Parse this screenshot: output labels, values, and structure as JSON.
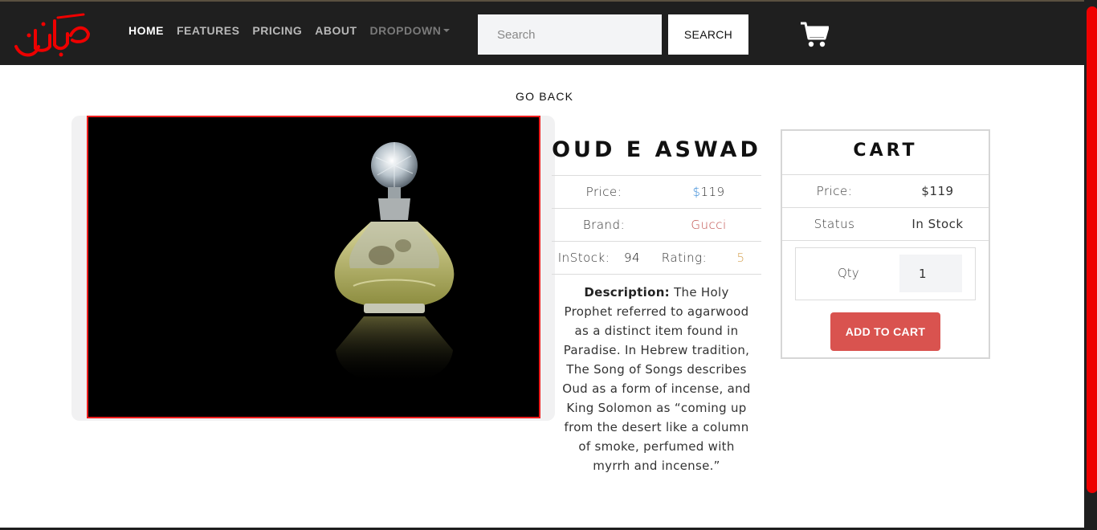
{
  "nav": {
    "logo_text": "مہکستان",
    "links": [
      {
        "label": "HOME"
      },
      {
        "label": "FEATURES"
      },
      {
        "label": "PRICING"
      },
      {
        "label": "ABOUT"
      },
      {
        "label": "DROPDOWN"
      }
    ],
    "search_placeholder": "Search",
    "search_button": "SEARCH",
    "cart_icon": "shopping-cart-icon"
  },
  "page": {
    "go_back": "GO BACK"
  },
  "product": {
    "title": "OUD E ASWAD",
    "price_label": "Price:",
    "price_symbol": "$",
    "price_value": "119",
    "brand_label": "Brand:",
    "brand_value": "Gucci",
    "instock_label": "InStock:",
    "instock_value": "94",
    "rating_label": "Rating:",
    "rating_value": "5",
    "description_label": "Description:",
    "description_text": "The Holy Prophet referred to agarwood as a distinct item found in Paradise. In Hebrew tradition, The Song of Songs describes Oud as a form of incense, and King Solomon as “coming up from the desert like a column of smoke, perfumed with myrrh and incense.”"
  },
  "cart": {
    "title": "CART",
    "price_label": "Price:",
    "price_value": "$119",
    "status_label": "Status",
    "status_value": "In Stock",
    "qty_label": "Qty",
    "qty_value": "1",
    "add_button": "ADD TO CART"
  },
  "colors": {
    "navbar": "#1f1f1f",
    "accent_red": "#ee1c1c",
    "add_button": "#d9534f",
    "brand_text": "#c0504d",
    "rating_text": "#d4a04f",
    "dollar_sign": "#3c8dd8"
  }
}
